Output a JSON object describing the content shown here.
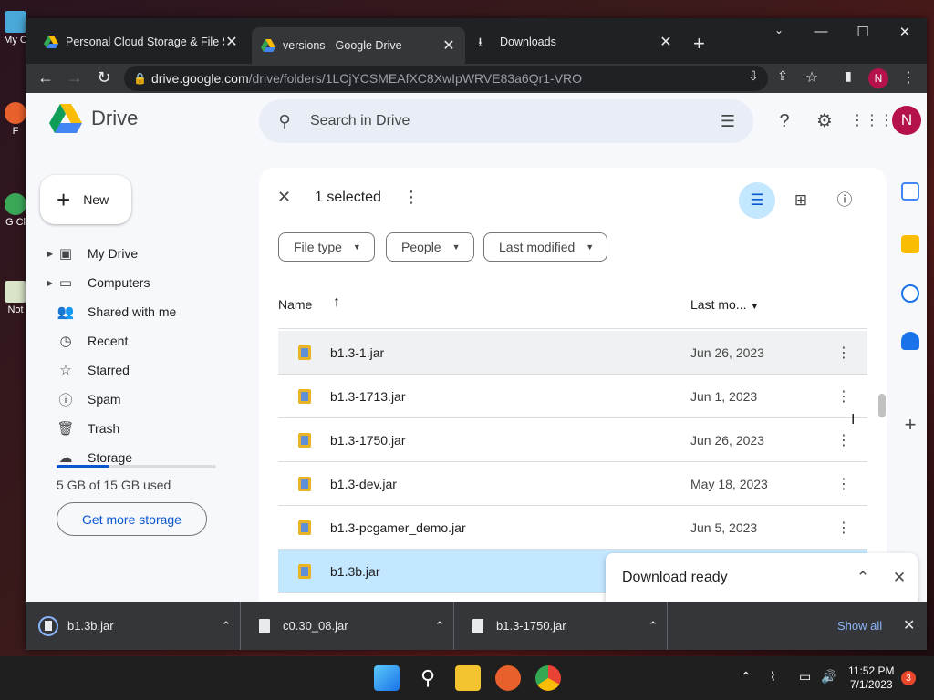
{
  "browser": {
    "tabs": [
      {
        "title": "Personal Cloud Storage & File Sh"
      },
      {
        "title": "versions - Google Drive"
      },
      {
        "title": "Downloads"
      }
    ],
    "url_host": "drive.google.com",
    "url_path": "/drive/folders/1LCjYCSMEAfXC8XwIpWRVE83a6Qr1-VRO",
    "profile_initial": "N"
  },
  "desktop": {
    "icons": [
      {
        "label": "My C"
      },
      {
        "label": "F"
      },
      {
        "label": "G Cl"
      },
      {
        "label": "Not"
      }
    ]
  },
  "drive": {
    "app_name": "Drive",
    "search_placeholder": "Search in Drive",
    "new_label": "New",
    "avatar_initial": "N",
    "nav": [
      {
        "label": "My Drive",
        "icon": "my-drive-icon"
      },
      {
        "label": "Computers",
        "icon": "computer-icon"
      },
      {
        "label": "Shared with me",
        "icon": "people-icon"
      },
      {
        "label": "Recent",
        "icon": "clock-icon"
      },
      {
        "label": "Starred",
        "icon": "star-icon"
      },
      {
        "label": "Spam",
        "icon": "spam-icon"
      },
      {
        "label": "Trash",
        "icon": "trash-icon"
      },
      {
        "label": "Storage",
        "icon": "cloud-icon"
      }
    ],
    "storage_text": "5 GB of 15 GB used",
    "storage_fraction": 0.33,
    "get_more_storage": "Get more storage",
    "selection": {
      "count_label": "1 selected"
    },
    "filters": [
      {
        "label": "File type"
      },
      {
        "label": "People"
      },
      {
        "label": "Last modified"
      }
    ],
    "columns": {
      "name": "Name",
      "modified": "Last mo..."
    },
    "files": [
      {
        "name": "b1.3-1.jar",
        "date": "Jun 26, 2023",
        "state": "hover"
      },
      {
        "name": "b1.3-1713.jar",
        "date": "Jun 1, 2023",
        "state": "normal"
      },
      {
        "name": "b1.3-1750.jar",
        "date": "Jun 26, 2023",
        "state": "normal"
      },
      {
        "name": "b1.3-dev.jar",
        "date": "May 18, 2023",
        "state": "normal"
      },
      {
        "name": "b1.3-pcgamer_demo.jar",
        "date": "Jun 5, 2023",
        "state": "normal"
      },
      {
        "name": "b1.3b.jar",
        "date": "",
        "state": "selected"
      }
    ],
    "toast": {
      "text": "Download ready"
    }
  },
  "downloads_shelf": {
    "items": [
      {
        "name": "b1.3b.jar"
      },
      {
        "name": "c0.30_08.jar"
      },
      {
        "name": "b1.3-1750.jar"
      }
    ],
    "show_all": "Show all"
  },
  "taskbar": {
    "time": "11:52 PM",
    "date": "7/1/2023",
    "notification_count": "3"
  }
}
